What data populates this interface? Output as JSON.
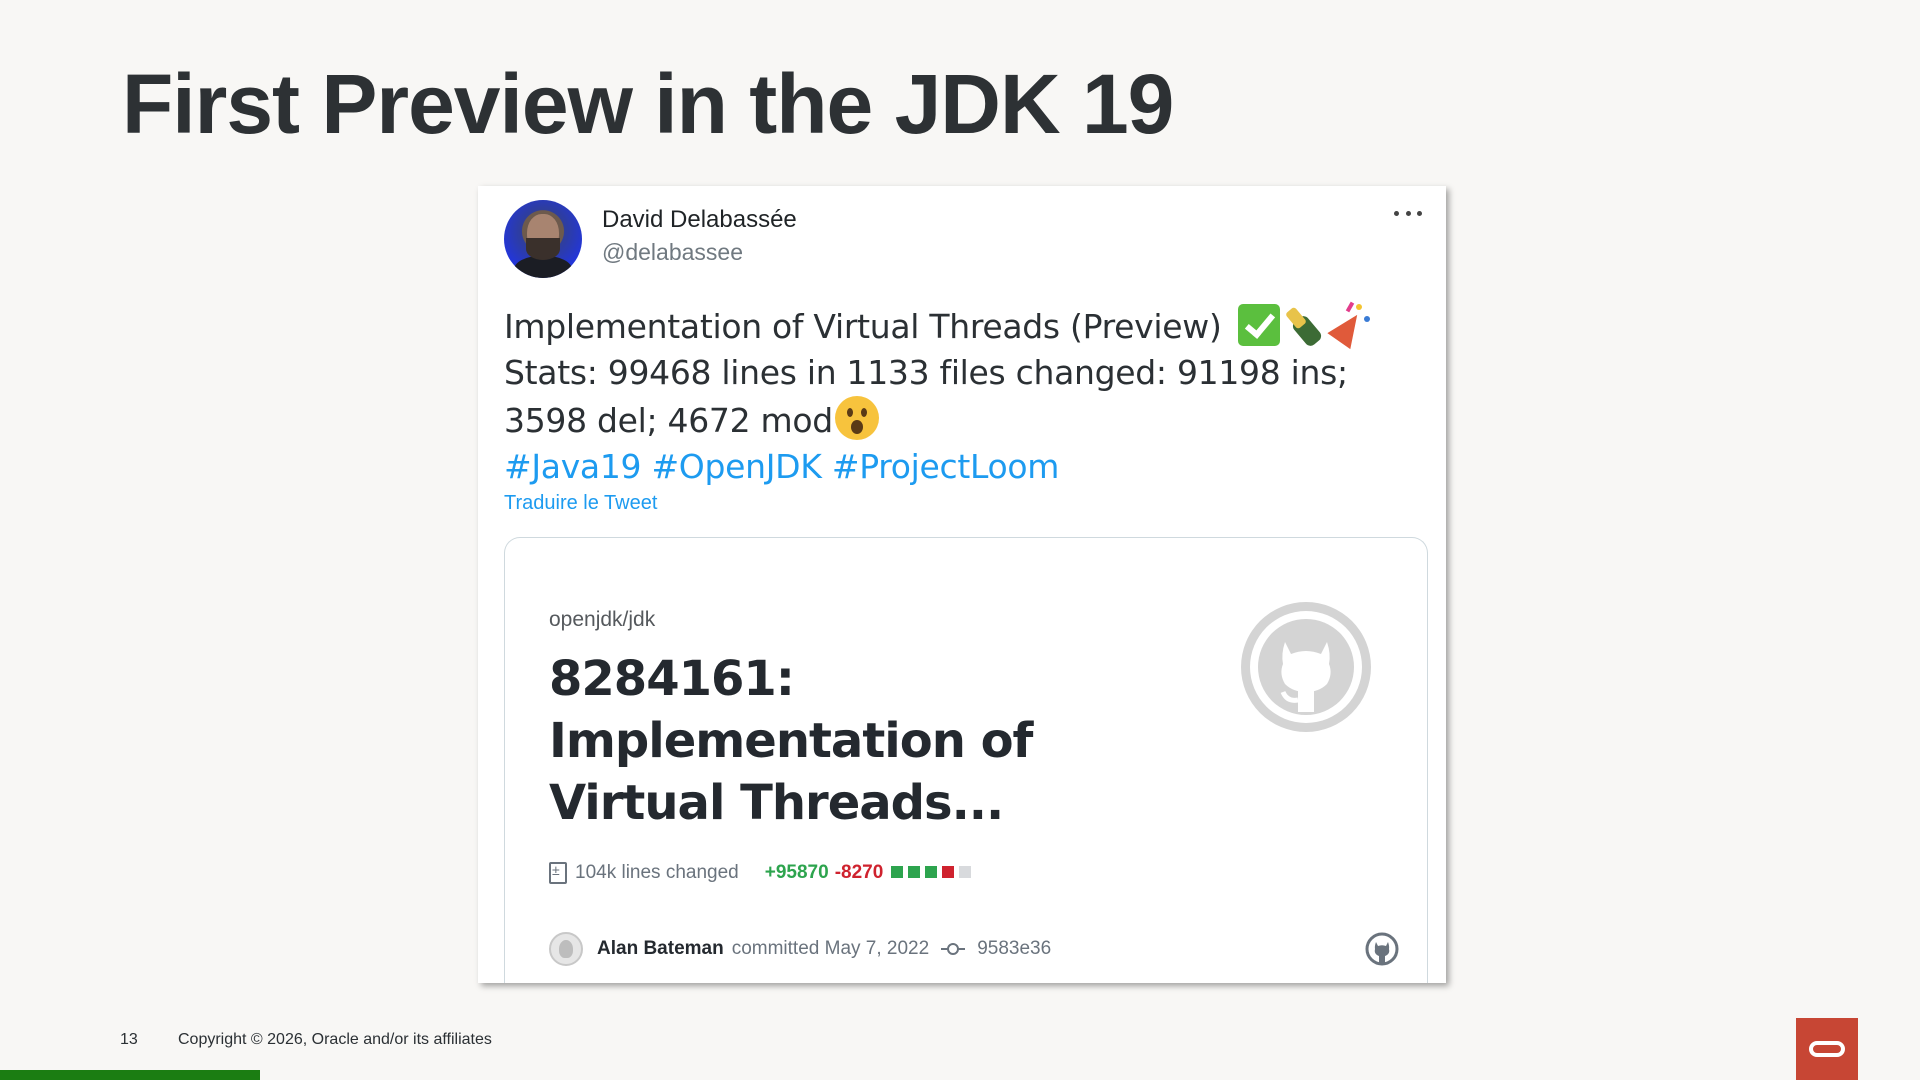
{
  "slide": {
    "title": "First Preview in the JDK 19",
    "number": "13",
    "copyright": "Copyright © 2026, Oracle and/or its affiliates"
  },
  "tweet": {
    "author": {
      "name": "David Delabassée",
      "handle": "@delabassee"
    },
    "text": {
      "line1": "Implementation of Virtual Threads (Preview)",
      "line2": "Stats: 99468 lines in 1133 files changed: 91198 ins;",
      "line3": "3598 del; 4672 mod",
      "hashtags": [
        "#Java19",
        "#OpenJDK",
        "#ProjectLoom"
      ]
    },
    "translate_label": "Traduire le Tweet",
    "card": {
      "repo": "openjdk/jdk",
      "title_line1": "8284161:",
      "title_line2": "Implementation of",
      "title_line3": "Virtual Threads...",
      "lines_changed": "104k lines changed",
      "additions": "+95870",
      "deletions": "-8270",
      "diff_colors": [
        "#2da44e",
        "#2da44e",
        "#2da44e",
        "#cf222e",
        "#d8dadd"
      ],
      "author": "Alan Bateman",
      "committed": "committed May 7, 2022",
      "sha": "9583e36"
    }
  },
  "colors": {
    "title": "#2d3134",
    "link": "#1d9bf0",
    "oracle_red": "#c74634",
    "bar_green": "#1b7d12"
  },
  "icons": [
    "more-icon",
    "check-mark-emoji",
    "champagne-emoji",
    "party-popper-emoji",
    "astonished-face-emoji",
    "github-octocat-icon",
    "diff-file-icon",
    "git-commit-icon",
    "oracle-logo"
  ]
}
